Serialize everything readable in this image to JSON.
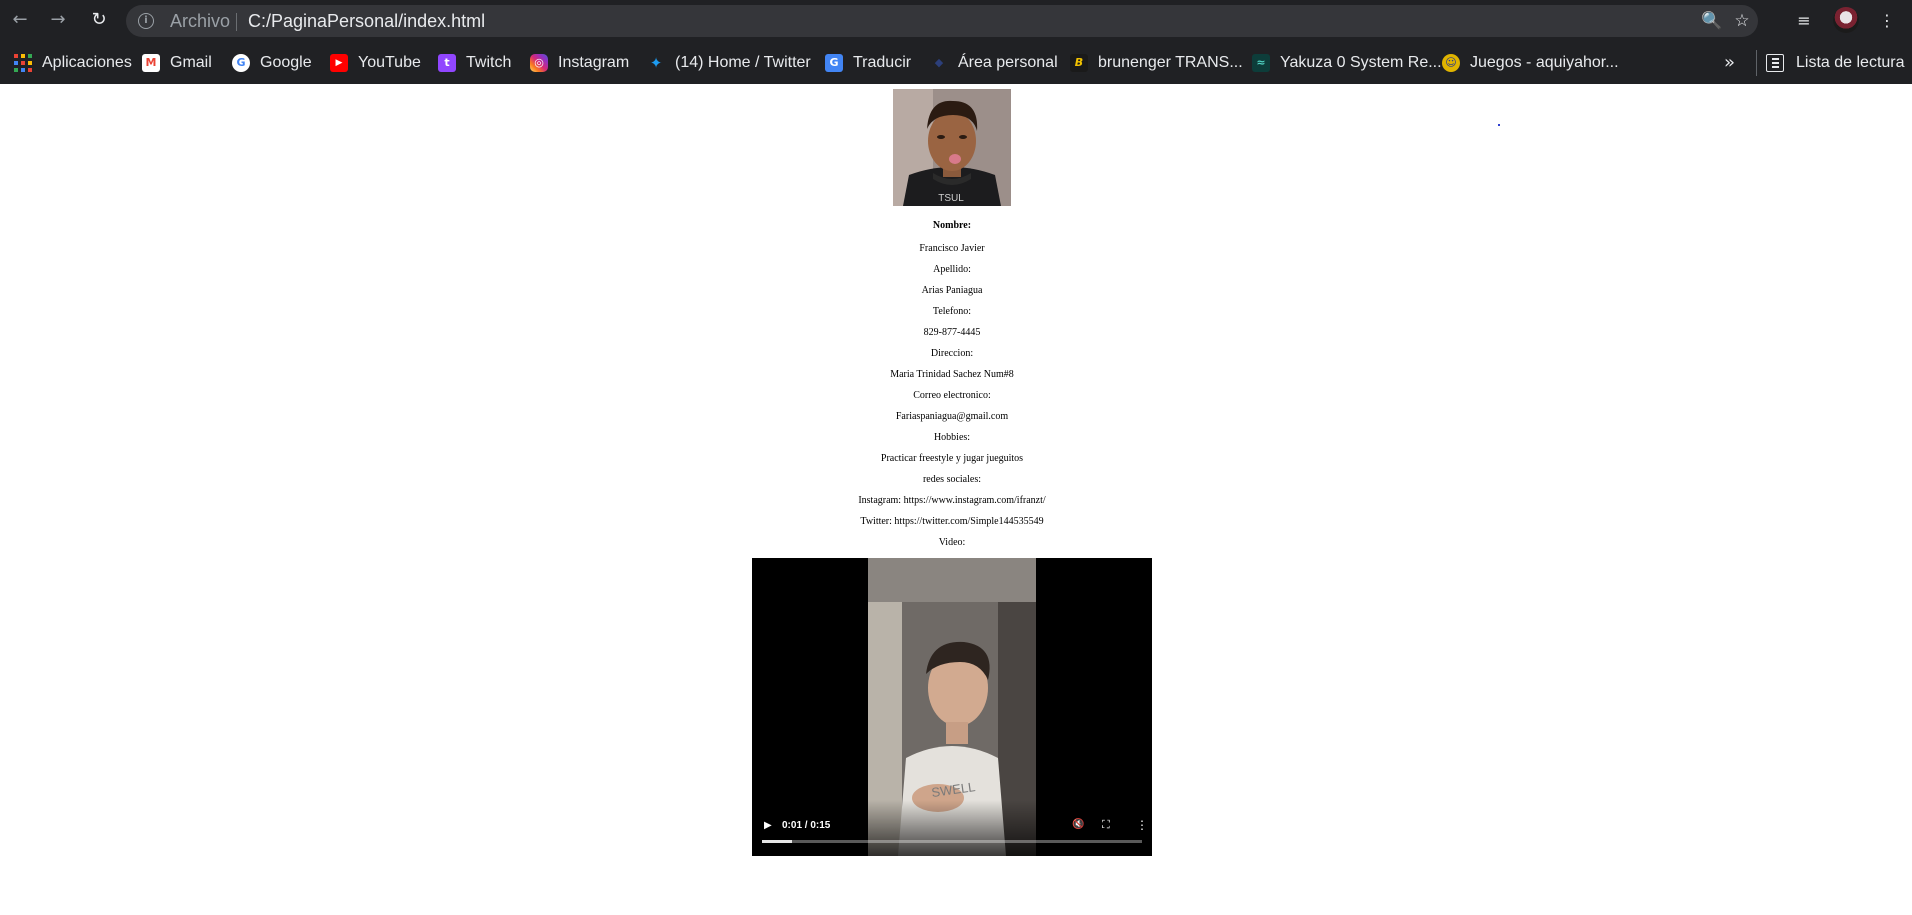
{
  "browser": {
    "url_scheme": "Archivo",
    "url": "C:/PaginaPersonal/index.html",
    "nav": {
      "back_icon": "←",
      "forward_icon": "→",
      "reload_icon": "↻"
    },
    "icons": {
      "zoom": "🔍",
      "star": "☆",
      "media": "≡",
      "menu": "⋮"
    },
    "bookmarks": [
      {
        "label": "Aplicaciones",
        "icon": "apps-grid-icon"
      },
      {
        "label": "Gmail",
        "icon": "gmail-icon",
        "glyph": "M",
        "color": "#ea4335"
      },
      {
        "label": "Google",
        "icon": "google-icon",
        "glyph": "G",
        "color": "#4285f4"
      },
      {
        "label": "YouTube",
        "icon": "youtube-icon",
        "glyph": "▶",
        "color": "#ff0000"
      },
      {
        "label": "Twitch",
        "icon": "twitch-icon",
        "glyph": "t",
        "color": "#9146ff"
      },
      {
        "label": "Instagram",
        "icon": "instagram-icon",
        "glyph": "◎",
        "color": "#d62976"
      },
      {
        "label": "(14) Home / Twitter",
        "icon": "twitter-icon",
        "glyph": "✦",
        "color": "#1d9bf0"
      },
      {
        "label": "Traducir",
        "icon": "translate-icon",
        "glyph": "G",
        "color": "#4285f4"
      },
      {
        "label": "Área personal",
        "icon": "area-personal-icon",
        "glyph": "◆",
        "color": "#1f2d5a"
      },
      {
        "label": "brunenger TRANS...",
        "icon": "brunenger-icon",
        "glyph": "B",
        "color": "#f2c200"
      },
      {
        "label": "Yakuza 0 System Re...",
        "icon": "yakuza-icon",
        "glyph": "≈",
        "color": "#0d3d3a"
      },
      {
        "label": "Juegos - aquiyahor...",
        "icon": "juegos-icon",
        "glyph": "☺",
        "color": "#e0b400"
      }
    ],
    "more_label": "»",
    "reading_list": "Lista de lectura"
  },
  "profile": {
    "fields": [
      {
        "text": "Nombre:",
        "bold": true
      },
      {
        "text": "Francisco Javier"
      },
      {
        "text": "Apellido:"
      },
      {
        "text": "Arias Paniagua"
      },
      {
        "text": "Telefono:"
      },
      {
        "text": "829-877-4445"
      },
      {
        "text": "Direccion:"
      },
      {
        "text": "Maria Trinidad Sachez Num#8"
      },
      {
        "text": "Correo electronico:"
      },
      {
        "text": "Fariaspaniagua@gmail.com"
      },
      {
        "text": "Hobbies:"
      },
      {
        "text": "Practicar freestyle y jugar jueguitos"
      },
      {
        "text": "redes sociales:"
      },
      {
        "text": "Instagram: https://www.instagram.com/ifranzt/"
      },
      {
        "text": "Twitter: https://twitter.com/Simple144535549"
      },
      {
        "text": "Video:"
      }
    ]
  },
  "video": {
    "time": "0:01 / 0:15",
    "progress": 0.08,
    "play_icon": "▶",
    "mute_icon": "🔇",
    "fullscreen_icon": "⛶",
    "more_icon": "⋮"
  }
}
